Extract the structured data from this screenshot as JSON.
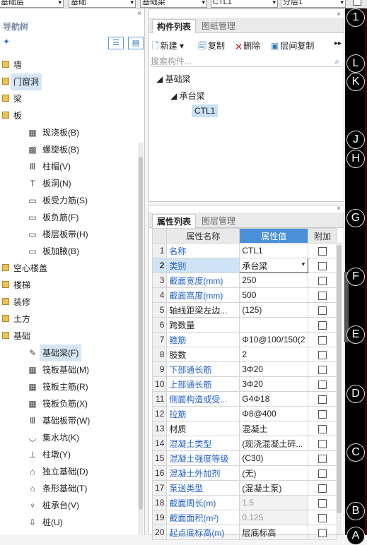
{
  "top": {
    "selectors": [
      "基础层",
      "基础",
      "基础梁",
      "CTL1",
      "分层1"
    ]
  },
  "nav": {
    "title": "导航树",
    "close": "×",
    "items": [
      {
        "label": "墙",
        "level": 0
      },
      {
        "label": "门窗洞",
        "level": 0
      },
      {
        "label": "梁",
        "level": 0
      },
      {
        "label": "板",
        "level": 0
      },
      {
        "label": "现浇板(B)",
        "level": 1
      },
      {
        "label": "螺旋板(B)",
        "level": 1
      },
      {
        "label": "柱帽(V)",
        "level": 1
      },
      {
        "label": "板洞(N)",
        "level": 1
      },
      {
        "label": "板受力筋(S)",
        "level": 1
      },
      {
        "label": "板负筋(F)",
        "level": 1
      },
      {
        "label": "楼层板带(H)",
        "level": 1
      },
      {
        "label": "板加腋(B)",
        "level": 1
      },
      {
        "label": "空心楼盖",
        "level": 0
      },
      {
        "label": "楼梯",
        "level": 0
      },
      {
        "label": "装修",
        "level": 0
      },
      {
        "label": "土方",
        "level": 0
      },
      {
        "label": "基础",
        "level": 0
      },
      {
        "label": "基础梁(F)",
        "level": 1
      },
      {
        "label": "筏板基础(M)",
        "level": 1
      },
      {
        "label": "筏板主筋(R)",
        "level": 1
      },
      {
        "label": "筏板负筋(X)",
        "level": 1
      },
      {
        "label": "基础板带(W)",
        "level": 1
      },
      {
        "label": "集水坑(K)",
        "level": 1
      },
      {
        "label": "柱墩(Y)",
        "level": 1
      },
      {
        "label": "独立基础(D)",
        "level": 1
      },
      {
        "label": "条形基础(T)",
        "level": 1
      },
      {
        "label": "桩承台(V)",
        "level": 1
      },
      {
        "label": "桩(U)",
        "level": 1
      }
    ]
  },
  "components": {
    "tab_active": "构件列表",
    "tab_inactive": "图纸管理",
    "close": "×",
    "tb_new": "新建",
    "tb_copy": "复制",
    "tb_delete": "删除",
    "tb_floorcopy": "层间复制",
    "search_placeholder": "搜索构件...",
    "tree_root": "基础梁",
    "tree_child": "承台梁",
    "tree_leaf": "CTL1"
  },
  "properties": {
    "tab_active": "属性列表",
    "tab_inactive": "图层管理",
    "close": "×",
    "col_name": "属性名称",
    "col_value": "属性值",
    "col_extra": "附加",
    "rows": [
      {
        "n": "1",
        "name": "名称",
        "value": "CTL1"
      },
      {
        "n": "2",
        "name": "类别",
        "value": "承台梁"
      },
      {
        "n": "3",
        "name": "截面宽度(mm)",
        "value": "250"
      },
      {
        "n": "4",
        "name": "截面高度(mm)",
        "value": "500"
      },
      {
        "n": "5",
        "name": "轴线距梁左边...",
        "value": "(125)"
      },
      {
        "n": "6",
        "name": "跨数量",
        "value": ""
      },
      {
        "n": "7",
        "name": "箍筋",
        "value": "Φ10@100/150(2"
      },
      {
        "n": "8",
        "name": "肢数",
        "value": "2"
      },
      {
        "n": "9",
        "name": "下部通长筋",
        "value": "3Φ20"
      },
      {
        "n": "10",
        "name": "上部通长筋",
        "value": "3Φ20"
      },
      {
        "n": "11",
        "name": "侧面构造或受...",
        "value": "G4Φ18"
      },
      {
        "n": "12",
        "name": "拉筋",
        "value": "Φ8@400"
      },
      {
        "n": "13",
        "name": "材质",
        "value": "混凝土"
      },
      {
        "n": "14",
        "name": "混凝土类型",
        "value": "(现浇混凝土碎..."
      },
      {
        "n": "15",
        "name": "混凝土强度等级",
        "value": "(C30)"
      },
      {
        "n": "16",
        "name": "混凝土外加剂",
        "value": "(无)"
      },
      {
        "n": "17",
        "name": "泵送类型",
        "value": "(混凝土泵)"
      },
      {
        "n": "18",
        "name": "截面周长(m)",
        "value": "1.5"
      },
      {
        "n": "19",
        "name": "截面面积(m²)",
        "value": "0.125"
      },
      {
        "n": "20",
        "name": "起点底标高(m)",
        "value": "层底标高"
      }
    ]
  },
  "axes": [
    "1",
    "L",
    "K",
    "J",
    "H",
    "G",
    "F",
    "E",
    "D",
    "C",
    "B",
    "A"
  ]
}
